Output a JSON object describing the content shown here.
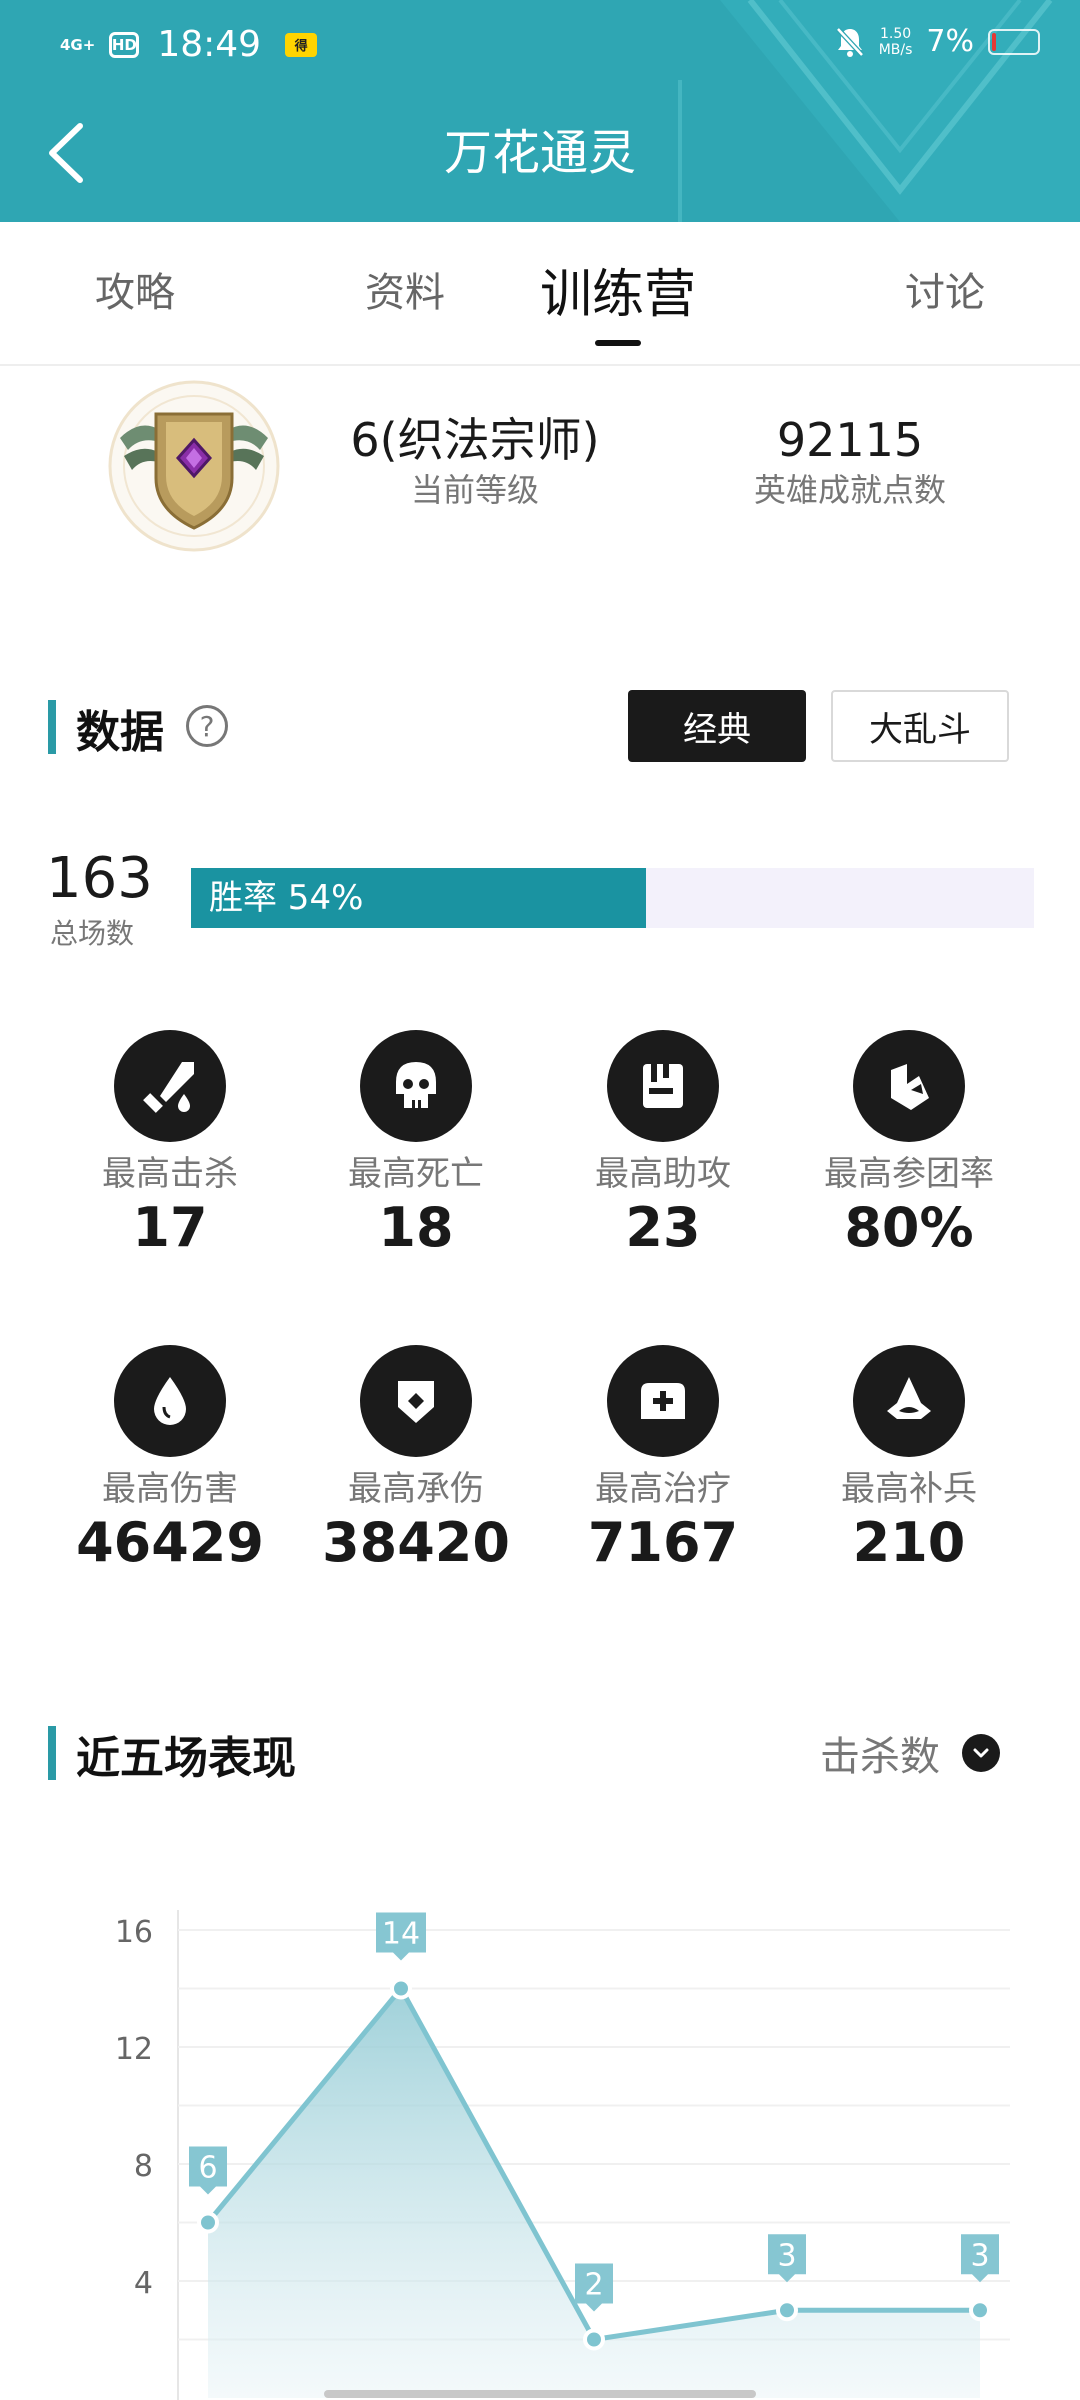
{
  "status_bar": {
    "network": "4G+",
    "hd": "HD",
    "time": "18:49",
    "app_badge": "得",
    "speed_value": "1.50",
    "speed_unit": "MB/s",
    "battery": "7%"
  },
  "header": {
    "title": "万花通灵",
    "back_icon": "chevron-left-icon"
  },
  "tabs": [
    {
      "label": "攻略",
      "active": false
    },
    {
      "label": "资料",
      "active": false
    },
    {
      "label": "训练营",
      "active": true
    },
    {
      "label": "讨论",
      "active": false
    }
  ],
  "profile": {
    "level_value": "6(织法宗师)",
    "level_label": "当前等级",
    "points_value": "92115",
    "points_label": "英雄成就点数"
  },
  "data_section": {
    "title": "数据",
    "help_icon": "?",
    "modes": [
      "经典",
      "大乱斗"
    ],
    "selected_mode": "经典",
    "total_games": "163",
    "total_label": "总场数",
    "win_rate_text": "胜率 54%",
    "win_rate": 0.54
  },
  "stats": [
    {
      "label": "最高击杀",
      "value": "17",
      "icon": "sword-icon"
    },
    {
      "label": "最高死亡",
      "value": "18",
      "icon": "skull-icon"
    },
    {
      "label": "最高助攻",
      "value": "23",
      "icon": "assist-icon"
    },
    {
      "label": "最高参团率",
      "value": "80%",
      "icon": "teamfight-icon"
    },
    {
      "label": "最高伤害",
      "value": "46429",
      "icon": "drop-icon"
    },
    {
      "label": "最高承伤",
      "value": "38420",
      "icon": "shield-icon"
    },
    {
      "label": "最高治疗",
      "value": "7167",
      "icon": "medkit-icon"
    },
    {
      "label": "最高补兵",
      "value": "210",
      "icon": "minion-icon"
    }
  ],
  "recent": {
    "title": "近五场表现",
    "metric": "击杀数"
  },
  "chart_data": {
    "type": "area",
    "x": [
      1,
      2,
      3,
      4,
      5
    ],
    "values": [
      6,
      14,
      2,
      3,
      3
    ],
    "data_labels": [
      "6",
      "14",
      "2",
      "3",
      "3"
    ],
    "y_ticks": [
      "16",
      "12",
      "8",
      "4"
    ],
    "ylim": [
      0,
      16
    ],
    "grid": true,
    "color": "#7fc4d0"
  }
}
